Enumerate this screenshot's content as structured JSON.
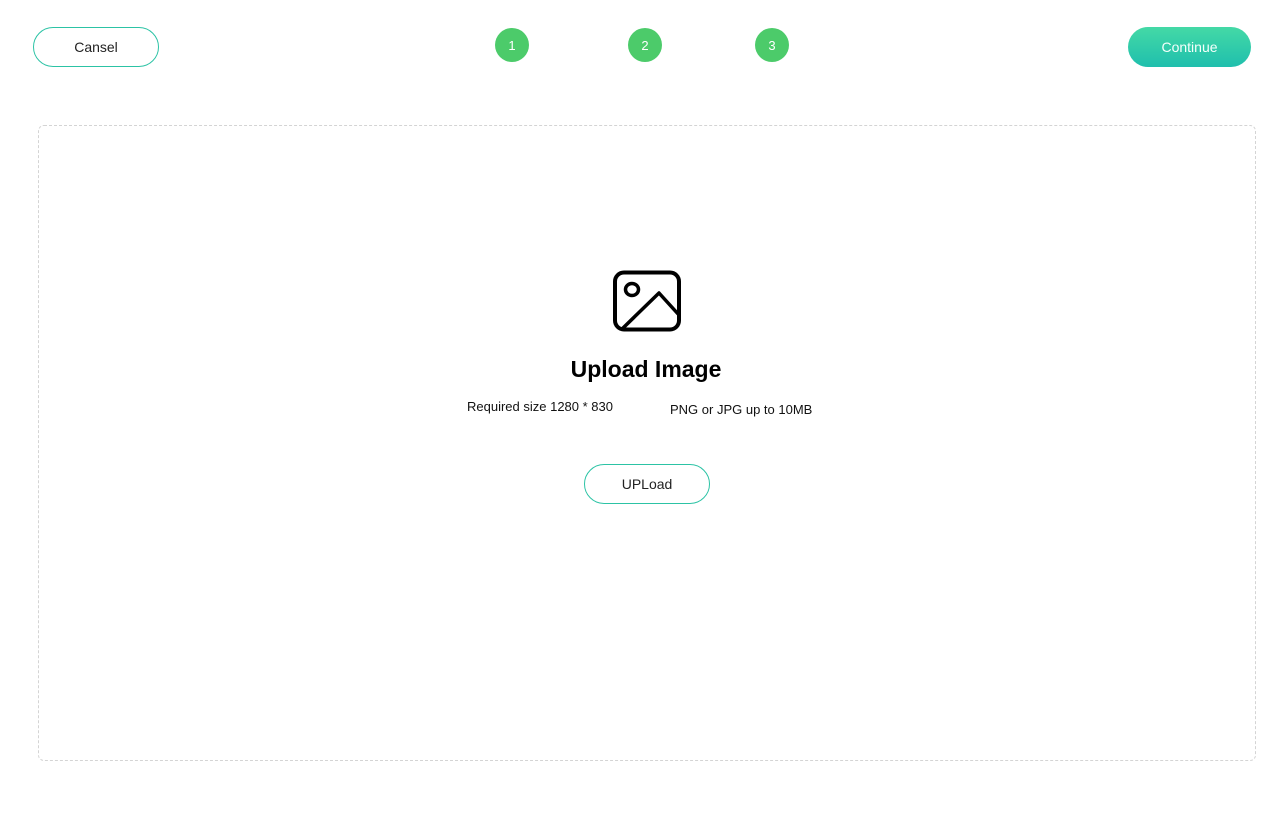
{
  "header": {
    "cancel_label": "Cansel",
    "continue_label": "Continue",
    "steps": [
      "1",
      "2",
      "3"
    ]
  },
  "dropzone": {
    "icon": "image-icon",
    "title": "Upload Image",
    "required_size": "Required size 1280 * 830",
    "file_types": "PNG or JPG up to 10MB",
    "upload_label": "UPLoad"
  },
  "colors": {
    "accent": "#2cc3a5",
    "step": "#4ccb6a",
    "continue_gradient_top": "#44d9a6",
    "continue_gradient_bottom": "#1fbfad"
  }
}
